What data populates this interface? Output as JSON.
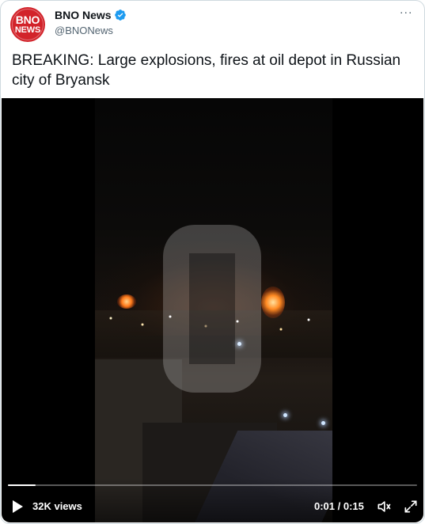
{
  "tweet": {
    "avatar": {
      "line1": "BNO",
      "line2": "NEWS",
      "color": "#d2232a"
    },
    "display_name": "BNO News",
    "verified_icon": "verified-badge-icon",
    "handle": "@BNONews",
    "more_label": "···",
    "text": "BREAKING: Large explosions, fires at oil depot in Russian city of Bryansk"
  },
  "video": {
    "views": "32K views",
    "current_time": "0:01",
    "duration": "0:15",
    "time_readout": "0:01 / 0:15",
    "progress": 0.067,
    "play_icon": "play-icon",
    "volume_icon": "volume-muted-icon",
    "fullscreen_icon": "fullscreen-icon"
  },
  "colors": {
    "verified": "#1d9bf0",
    "text_secondary": "#536471",
    "border": "#cfd9de"
  }
}
